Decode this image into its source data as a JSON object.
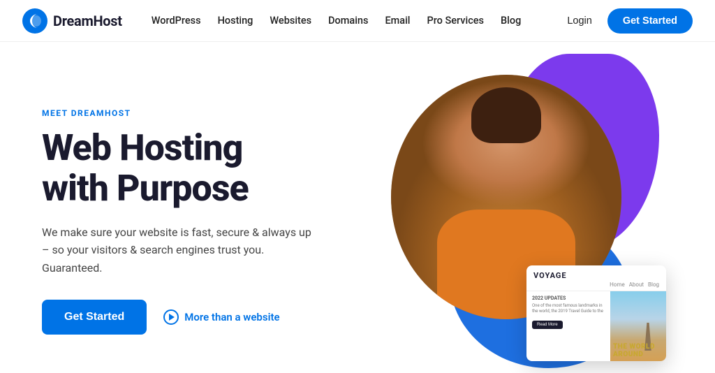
{
  "header": {
    "logo_text": "DreamHost",
    "nav_items": [
      {
        "label": "WordPress",
        "id": "wordpress"
      },
      {
        "label": "Hosting",
        "id": "hosting"
      },
      {
        "label": "Websites",
        "id": "websites"
      },
      {
        "label": "Domains",
        "id": "domains"
      },
      {
        "label": "Email",
        "id": "email"
      },
      {
        "label": "Pro Services",
        "id": "pro-services"
      },
      {
        "label": "Blog",
        "id": "blog"
      }
    ],
    "login_label": "Login",
    "cta_label": "Get Started"
  },
  "hero": {
    "meet_label": "MEET DREAMHOST",
    "title_line1": "Web Hosting",
    "title_line2": "with Purpose",
    "description": "We make sure your website is fast, secure & always up – so your visitors & search engines trust you. Guaranteed.",
    "cta_label": "Get Started",
    "more_link_label": "More than a website",
    "card": {
      "title": "VOYAGE",
      "subtitle": "2022 UPDATES",
      "body": "One of the most famous landmarks in the world, the 2019 Travel Guide to the",
      "btn_label": "Read More",
      "big_text": "THE WORLD\nAROUND"
    }
  }
}
